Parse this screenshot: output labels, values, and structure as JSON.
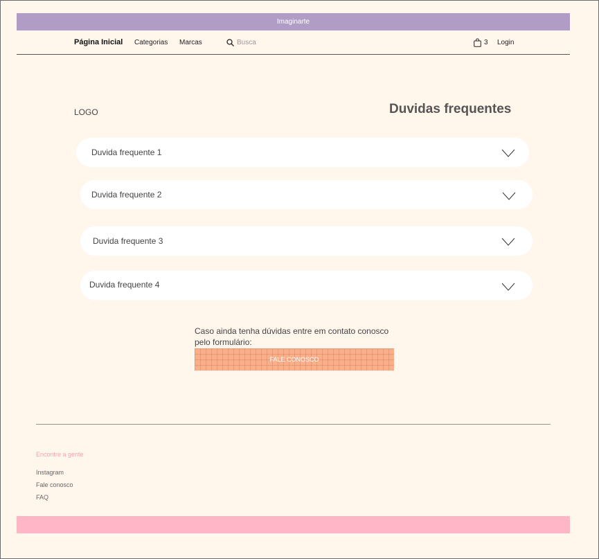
{
  "header": {
    "brand_bar_text": "Imaginarte"
  },
  "nav": {
    "home_label": "Página Inicial",
    "categories_label": "Categorias",
    "brands_label": "Marcas",
    "search_placeholder": "Busca",
    "cart_count": "3",
    "login_label": "Login"
  },
  "main": {
    "logo_text": "LOGO",
    "title": "Duvidas frequentes",
    "faq": [
      {
        "question": "Duvida  frequente 1"
      },
      {
        "question": "Duvida  frequente 2"
      },
      {
        "question": "Duvida  frequente 3"
      },
      {
        "question": "Duvida  frequente 4"
      }
    ],
    "contact_text": "Caso ainda tenha dúvidas entre em contato conosco pelo formulário:",
    "contact_button_label": "FALE CONOSCO"
  },
  "footer": {
    "heading": "Encontre a gente",
    "links": [
      "Instagram",
      "Fale conosco",
      "FAQ"
    ]
  },
  "colors": {
    "background": "#fff6ec",
    "brand_bar": "#b09cc4",
    "footer_bar": "#ffb6c6",
    "button": "#f9b08a",
    "footer_heading": "#f4a0b4"
  },
  "icons": [
    "search-icon",
    "shopping-bag-icon",
    "chevron-down-icon"
  ]
}
